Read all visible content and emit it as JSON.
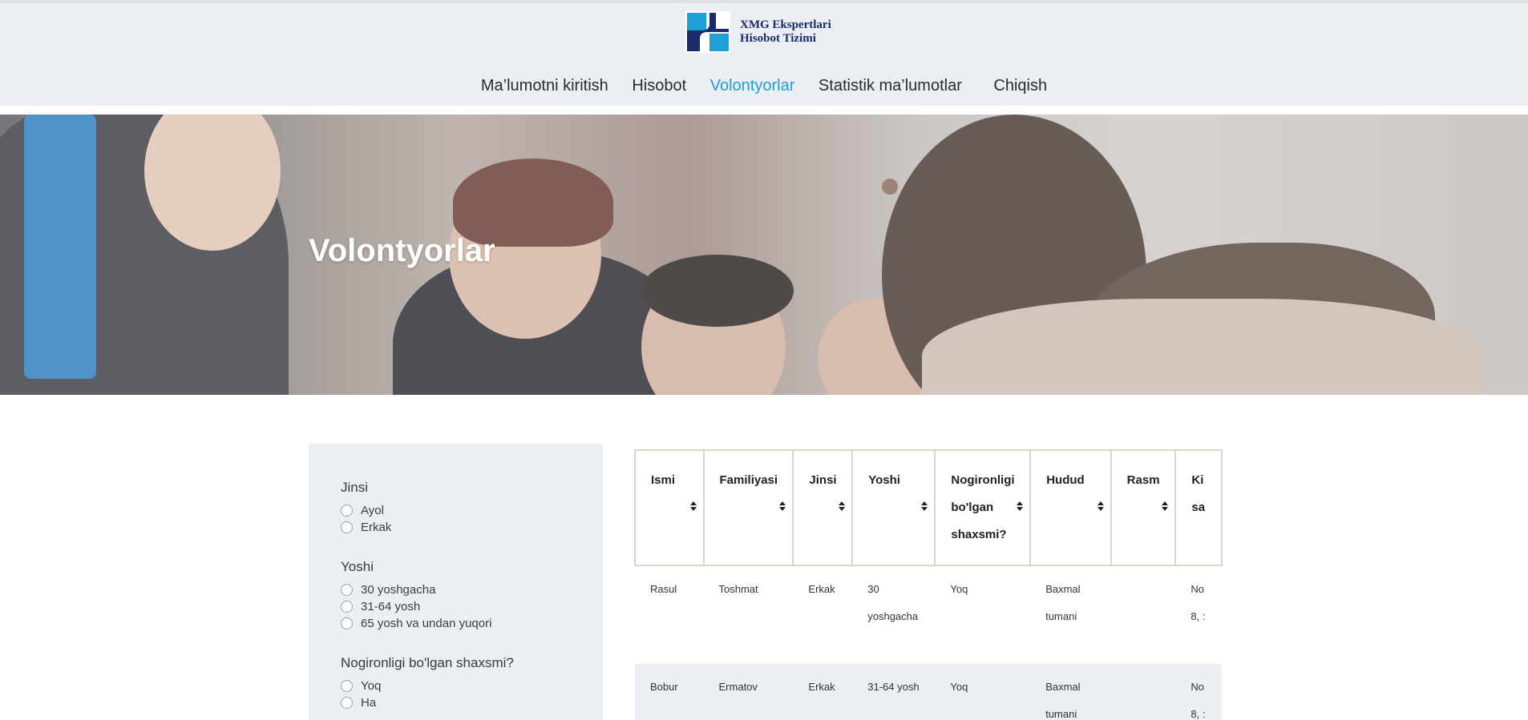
{
  "logo": {
    "line1": "XMG Ekspertlari",
    "line2": "Hisobot Tizimi",
    "color": "#1b2a6b",
    "accent": "#1ea0d6"
  },
  "nav": {
    "items": [
      {
        "label": "Ma’lumotni kiritish",
        "active": false
      },
      {
        "label": "Hisobot",
        "active": false
      },
      {
        "label": "Volontyorlar",
        "active": true
      },
      {
        "label": "Statistik ma’lumotlar",
        "active": false
      },
      {
        "label": "Chiqish",
        "active": false
      }
    ],
    "active_color": "#1ea0d6"
  },
  "hero": {
    "title": "Volontyorlar"
  },
  "filters": [
    {
      "title": "Jinsi",
      "options": [
        "Ayol",
        "Erkak"
      ]
    },
    {
      "title": "Yoshi",
      "options": [
        "30 yoshgacha",
        "31-64 yosh",
        "65 yosh va undan yuqori"
      ]
    },
    {
      "title": "Nogironligi bo'lgan shaxsmi?",
      "options": [
        "Yoq",
        "Ha"
      ]
    }
  ],
  "table": {
    "headers": [
      "Ismi",
      "Familiyasi",
      "Jinsi",
      "Yoshi",
      "Nogironligi bo'lgan shaxsmi?",
      "Hudud",
      "Rasm",
      "Ki sa"
    ],
    "rows": [
      [
        "Rasul",
        "Toshmat",
        "Erkak",
        "30 yoshgacha",
        "Yoq",
        "Baxmal tumani",
        "",
        "No 8, :"
      ],
      [
        "Bobur",
        "Ermatov",
        "Erkak",
        "31-64 yosh",
        "Yoq",
        "Baxmal tumani",
        "",
        "No 8, :"
      ]
    ]
  }
}
